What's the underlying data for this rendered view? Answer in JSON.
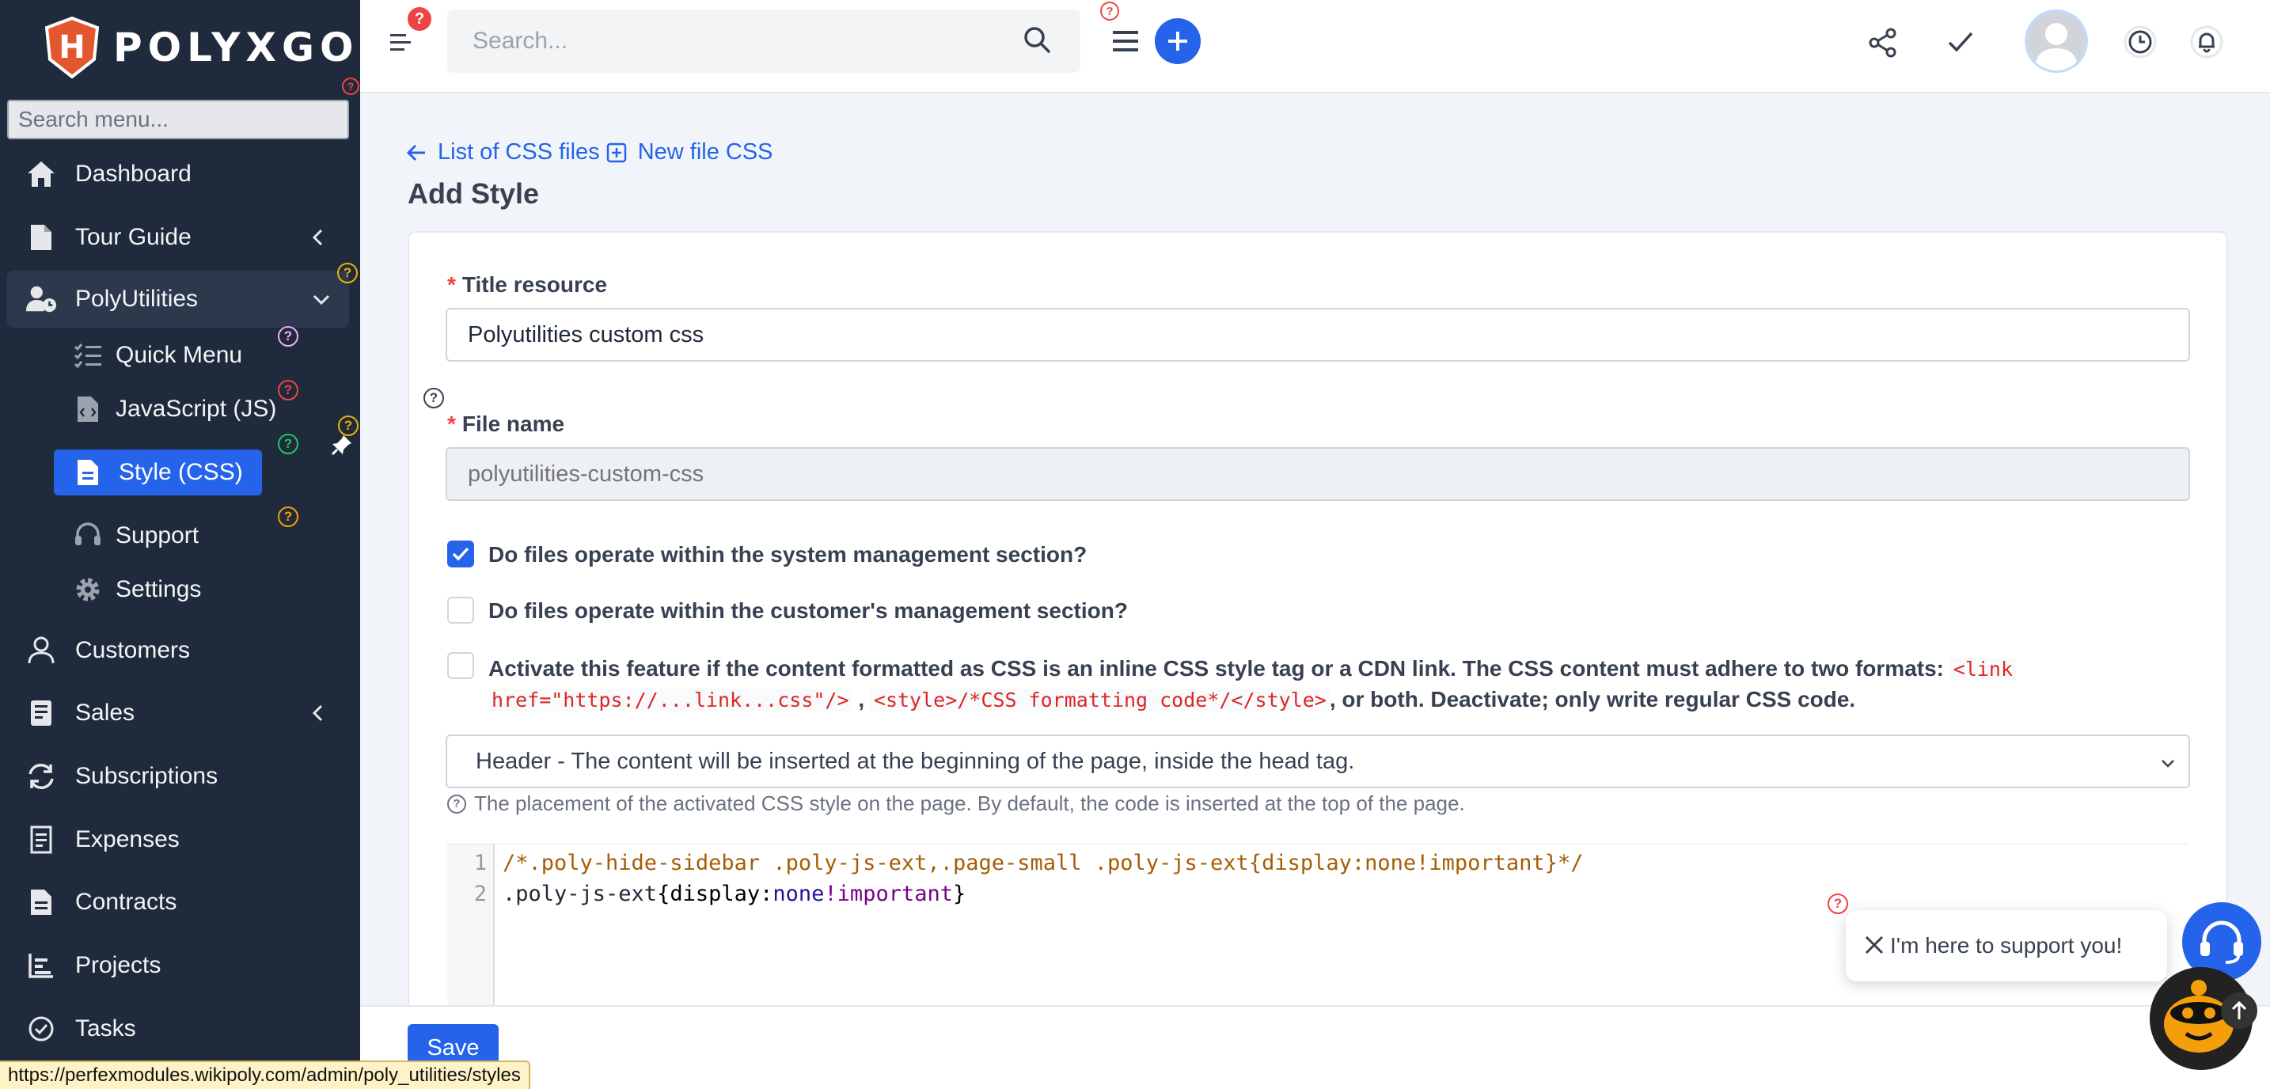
{
  "brand": {
    "name": "POLYXGO",
    "shield_letter": "H"
  },
  "sidebar": {
    "search_placeholder": "Search menu...",
    "items": [
      {
        "label": "Dashboard",
        "icon": "home-icon"
      },
      {
        "label": "Tour Guide",
        "icon": "file-icon"
      },
      {
        "label": "PolyUtilities",
        "icon": "user-clock-icon"
      },
      {
        "label": "Customers",
        "icon": "user-icon"
      },
      {
        "label": "Sales",
        "icon": "book-icon"
      },
      {
        "label": "Subscriptions",
        "icon": "refresh-icon"
      },
      {
        "label": "Expenses",
        "icon": "receipt-icon"
      },
      {
        "label": "Contracts",
        "icon": "contract-icon"
      },
      {
        "label": "Projects",
        "icon": "chart-icon"
      },
      {
        "label": "Tasks",
        "icon": "check-circle-icon"
      }
    ],
    "sub_items": [
      {
        "label": "Quick Menu",
        "icon": "list-check-icon"
      },
      {
        "label": "JavaScript (JS)",
        "icon": "js-file-icon"
      },
      {
        "label": "Style (CSS)",
        "icon": "file-text-icon"
      },
      {
        "label": "Support",
        "icon": "headset-icon"
      },
      {
        "label": "Settings",
        "icon": "gear-icon"
      }
    ]
  },
  "topbar": {
    "search_placeholder": "Search...",
    "notification_count": "?",
    "help_mark": "?"
  },
  "breadcrumbs": {
    "back_label": "List of CSS files",
    "new_label": "New file CSS"
  },
  "page": {
    "title": "Add Style"
  },
  "form": {
    "title_label": "Title resource",
    "title_value": "Polyutilities custom css",
    "filename_label": "File name",
    "filename_placeholder": "polyutilities-custom-css",
    "required_mark": "*",
    "check_system": {
      "label": "Do files operate within the system management section?",
      "checked": true
    },
    "check_customer": {
      "label": "Do files operate within the customer's management section?",
      "checked": false
    },
    "check_inline": {
      "checked": false,
      "text_1": "Activate this feature if the content formatted as CSS is an inline CSS style tag or a CDN link. The CSS content must adhere to two formats:",
      "code_1a": "<link",
      "code_1b": "href=\"https://...link...css\"/>",
      "sep": ",",
      "code_2": "<style>/*CSS formatting code*/</style>",
      "text_2": ", or both. Deactivate; only write regular CSS code."
    },
    "placement_value": "Header - The content will be inserted at the beginning of the page, inside the head tag.",
    "placement_hint": "The placement of the activated CSS style on the page. By default, the code is inserted at the top of the page.",
    "code_lines": [
      {
        "num": "1",
        "text": "/*.poly-hide-sidebar .poly-js-ext,.page-small .poly-js-ext{display:none!important}*/"
      },
      {
        "num": "2",
        "selector": ".poly-js-ext",
        "open": "{",
        "prop": "display:",
        "value": "none",
        "imp": "!important",
        "close": "}"
      }
    ],
    "save_label": "Save"
  },
  "support": {
    "bubble_text": "I'm here to support you!"
  },
  "status_url": "https://perfexmodules.wikipoly.com/admin/poly_utilities/styles",
  "colors": {
    "sidebar_bg": "#1f2a3c",
    "accent": "#2563eb",
    "brand_shield": "#e4572e"
  }
}
